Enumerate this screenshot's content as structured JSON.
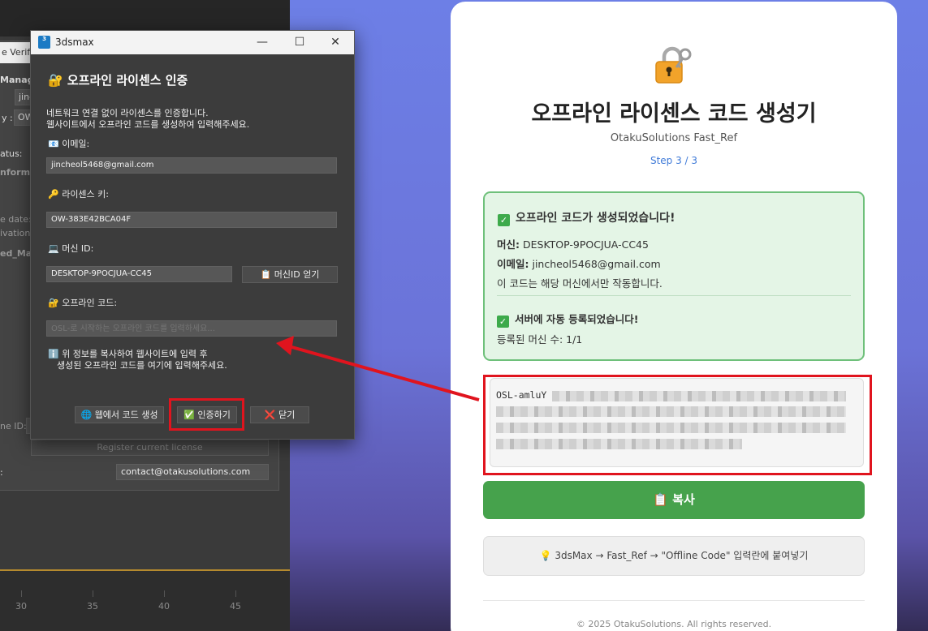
{
  "max_background": {
    "tab_label": "e Verifi",
    "labels": {
      "manager": "Manag",
      "user_field": "jinc",
      "key_label": "y :",
      "key_field": "OW",
      "status": "atus:",
      "information": "nforma",
      "issue_date": "e date:",
      "activations": "ivations",
      "activated_machines": "ed_Mac",
      "machine_id": "ne ID:"
    },
    "register_button": "Register current license",
    "contact_label": ":",
    "contact_email": "contact@otakusolutions.com",
    "timeline_ticks": [
      "30",
      "35",
      "40",
      "45"
    ]
  },
  "dialog": {
    "window_title": "3dsmax",
    "app_icon_text": "3",
    "heading": "🔐 오프라인 라이센스 인증",
    "description_line1": "네트워크 연결 없이 라이센스를 인증합니다.",
    "description_line2": "웹사이트에서 오프라인 코드를 생성하여 입력해주세요.",
    "email_label": "📧 이메일:",
    "email_value": "jincheol5468@gmail.com",
    "license_label": "🔑 라이센스 키:",
    "license_value": "OW-383E42BCA04F",
    "machine_label": "💻 머신 ID:",
    "machine_value": "DESKTOP-9POCJUA-CC45",
    "copy_machine_button": "📋 머신ID 얻기",
    "offline_label": "🔐 오프라인 코드:",
    "offline_placeholder": "OSL-로 시작하는 오프라인 코드를 입력하세요...",
    "info_line1": "ℹ️ 위 정보를 복사하여 웹사이트에 입력 후",
    "info_line2": "생성된 오프라인 코드를 여기에 입력해주세요.",
    "web_button": "🌐 웹에서 코드 생성",
    "verify_button": "✅ 인증하기",
    "close_button": "❌ 닫기"
  },
  "web": {
    "title": "오프라인 라이센스 코드 생성기",
    "subtitle": "OtakuSolutions Fast_Ref",
    "step": "Step 3 / 3",
    "success_heading": "오프라인 코드가 생성되었습니다!",
    "machine_label": "머신:",
    "machine_value": "DESKTOP-9POCJUA-CC45",
    "email_label": "이메일:",
    "email_value": "jincheol5468@gmail.com",
    "machine_note": "이 코드는 해당 머신에서만 작동합니다.",
    "server_heading": "서버에 자동 등록되었습니다!",
    "registered_count": "등록된 머신 수: 1/1",
    "code_prefix": "OSL-amluY",
    "copy_button": "📋 복사",
    "hint": "💡 3dsMax → Fast_Ref → \"Offline Code\" 입력란에 붙여넣기",
    "footer": "© 2025 OtakuSolutions. All rights reserved."
  },
  "colors": {
    "highlight_red": "#e0141e",
    "success_green": "#46a24c",
    "step_blue": "#3f7ad8"
  }
}
